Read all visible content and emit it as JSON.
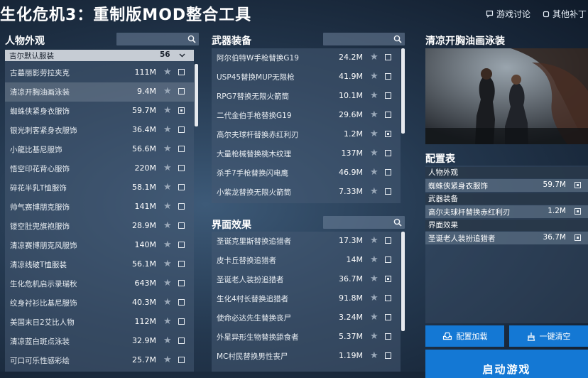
{
  "app": {
    "title": "生化危机3：重制版MOD整合工具"
  },
  "header": {
    "discussion_label": "游戏讨论",
    "other_label": "其他补丁"
  },
  "character": {
    "title": "人物外观",
    "group": {
      "label": "吉尔默认服装",
      "count": "56"
    },
    "items": [
      {
        "name": "古墓丽影劳拉夹克",
        "size": "111M",
        "checked": false
      },
      {
        "name": "清凉开胸油画泳装",
        "size": "9.4M",
        "checked": false
      },
      {
        "name": "蜘蛛侠紧身衣服饰",
        "size": "59.7M",
        "checked": true
      },
      {
        "name": "银光刺客紧身衣服饰",
        "size": "36.4M",
        "checked": false
      },
      {
        "name": "小龍比基尼服饰",
        "size": "56.6M",
        "checked": false
      },
      {
        "name": "悟空印花背心服饰",
        "size": "220M",
        "checked": false
      },
      {
        "name": "碎花半乳T恤服饰",
        "size": "58.1M",
        "checked": false
      },
      {
        "name": "帅气赛博朋克服饰",
        "size": "141M",
        "checked": false
      },
      {
        "name": "镂空肚兜旗袍服饰",
        "size": "28.9M",
        "checked": false
      },
      {
        "name": "清凉赛博朋克风服饰",
        "size": "140M",
        "checked": false
      },
      {
        "name": "清凉线破T恤服装",
        "size": "56.1M",
        "checked": false
      },
      {
        "name": "生化危机启示录瑞秋",
        "size": "643M",
        "checked": false
      },
      {
        "name": "纹身衬衫比基尼服饰",
        "size": "40.3M",
        "checked": false
      },
      {
        "name": "美国末日2艾比人物",
        "size": "112M",
        "checked": false
      },
      {
        "name": "清凉蓝白斑点泳装",
        "size": "32.9M",
        "checked": false
      },
      {
        "name": "可口可乐性感彩绘",
        "size": "25.7M",
        "checked": false
      }
    ]
  },
  "weapons": {
    "title": "武器装备",
    "items": [
      {
        "name": "阿尔伯特W手枪替换G19",
        "size": "24.2M",
        "checked": false
      },
      {
        "name": "USP45替换MUP无限枪",
        "size": "41.9M",
        "checked": false
      },
      {
        "name": "RPG7替换无限火箭筒",
        "size": "10.1M",
        "checked": false
      },
      {
        "name": "二代金伯手枪替换G19",
        "size": "29.6M",
        "checked": false
      },
      {
        "name": "高尔夫球杆替换赤红利刃",
        "size": "1.2M",
        "checked": true
      },
      {
        "name": "大量枪械替换桃木纹理",
        "size": "137M",
        "checked": false
      },
      {
        "name": "杀手7手枪替换闪电鹰",
        "size": "46.9M",
        "checked": false
      },
      {
        "name": "小紫龙替换无限火箭筒",
        "size": "7.33M",
        "checked": false
      }
    ]
  },
  "ui_effects": {
    "title": "界面效果",
    "items": [
      {
        "name": "圣诞克里斯替换追猎者",
        "size": "17.3M",
        "checked": false
      },
      {
        "name": "皮卡丘替换追猎者",
        "size": "14M",
        "checked": false
      },
      {
        "name": "圣诞老人装扮追猎者",
        "size": "36.7M",
        "checked": true
      },
      {
        "name": "生化4村长替换追猎者",
        "size": "91.8M",
        "checked": false
      },
      {
        "name": "使命必达先生替换丧尸",
        "size": "3.24M",
        "checked": false
      },
      {
        "name": "外星异形生物替换舔食者",
        "size": "5.37M",
        "checked": false
      },
      {
        "name": "MC村民替换男性丧尸",
        "size": "1.19M",
        "checked": false
      }
    ]
  },
  "preview": {
    "title": "清凉开胸油画泳装"
  },
  "config": {
    "title": "配置表",
    "categories": [
      {
        "label": "人物外观",
        "item": {
          "name": "蜘蛛侠紧身衣服饰",
          "size": "59.7M"
        }
      },
      {
        "label": "武器装备",
        "item": {
          "name": "高尔夫球杆替换赤红利刃",
          "size": "1.2M"
        }
      },
      {
        "label": "界面效果",
        "item": {
          "name": "圣诞老人装扮追猎者",
          "size": "36.7M"
        }
      }
    ]
  },
  "actions": {
    "load_label": "配置加载",
    "clear_label": "一键清空",
    "launch_label": "启动游戏"
  },
  "colors": {
    "accent": "#1478d4"
  }
}
